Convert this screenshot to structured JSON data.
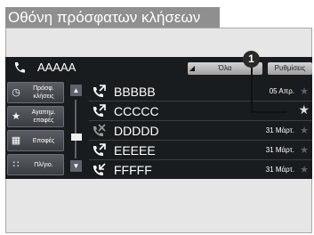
{
  "title": "Οθόνη πρόσφατων κλήσεων",
  "callout_number": "1",
  "header": {
    "caller": "AAAAA",
    "filter_label": "Όλα",
    "settings_label": "Ρυθμίσεις"
  },
  "sidebar": {
    "items": [
      {
        "icon": "history-icon",
        "label": "Πρόσφ.\nκλήσεις"
      },
      {
        "icon": "star-icon",
        "label": "Αγαπημ.\nεπαφές"
      },
      {
        "icon": "contacts-icon",
        "label": "Επαφές"
      },
      {
        "icon": "keypad-icon",
        "label": "Πλ/γιο."
      }
    ]
  },
  "calls": [
    {
      "type": "outgoing",
      "name": "BBBBB",
      "date": "05 Απρ."
    },
    {
      "type": "outgoing",
      "name": "CCCCC",
      "date": ""
    },
    {
      "type": "missed",
      "name": "DDDDD",
      "date": "31 Μάρτ."
    },
    {
      "type": "outgoing",
      "name": "EEEEE",
      "date": "31 Μάρτ."
    },
    {
      "type": "incoming",
      "name": "FFFFF",
      "date": "31 Μάρτ."
    }
  ],
  "colors": {
    "screen_bg": "#191c1f",
    "title_bg": "#8f8f8f",
    "button_bg": "#4a4d52"
  }
}
